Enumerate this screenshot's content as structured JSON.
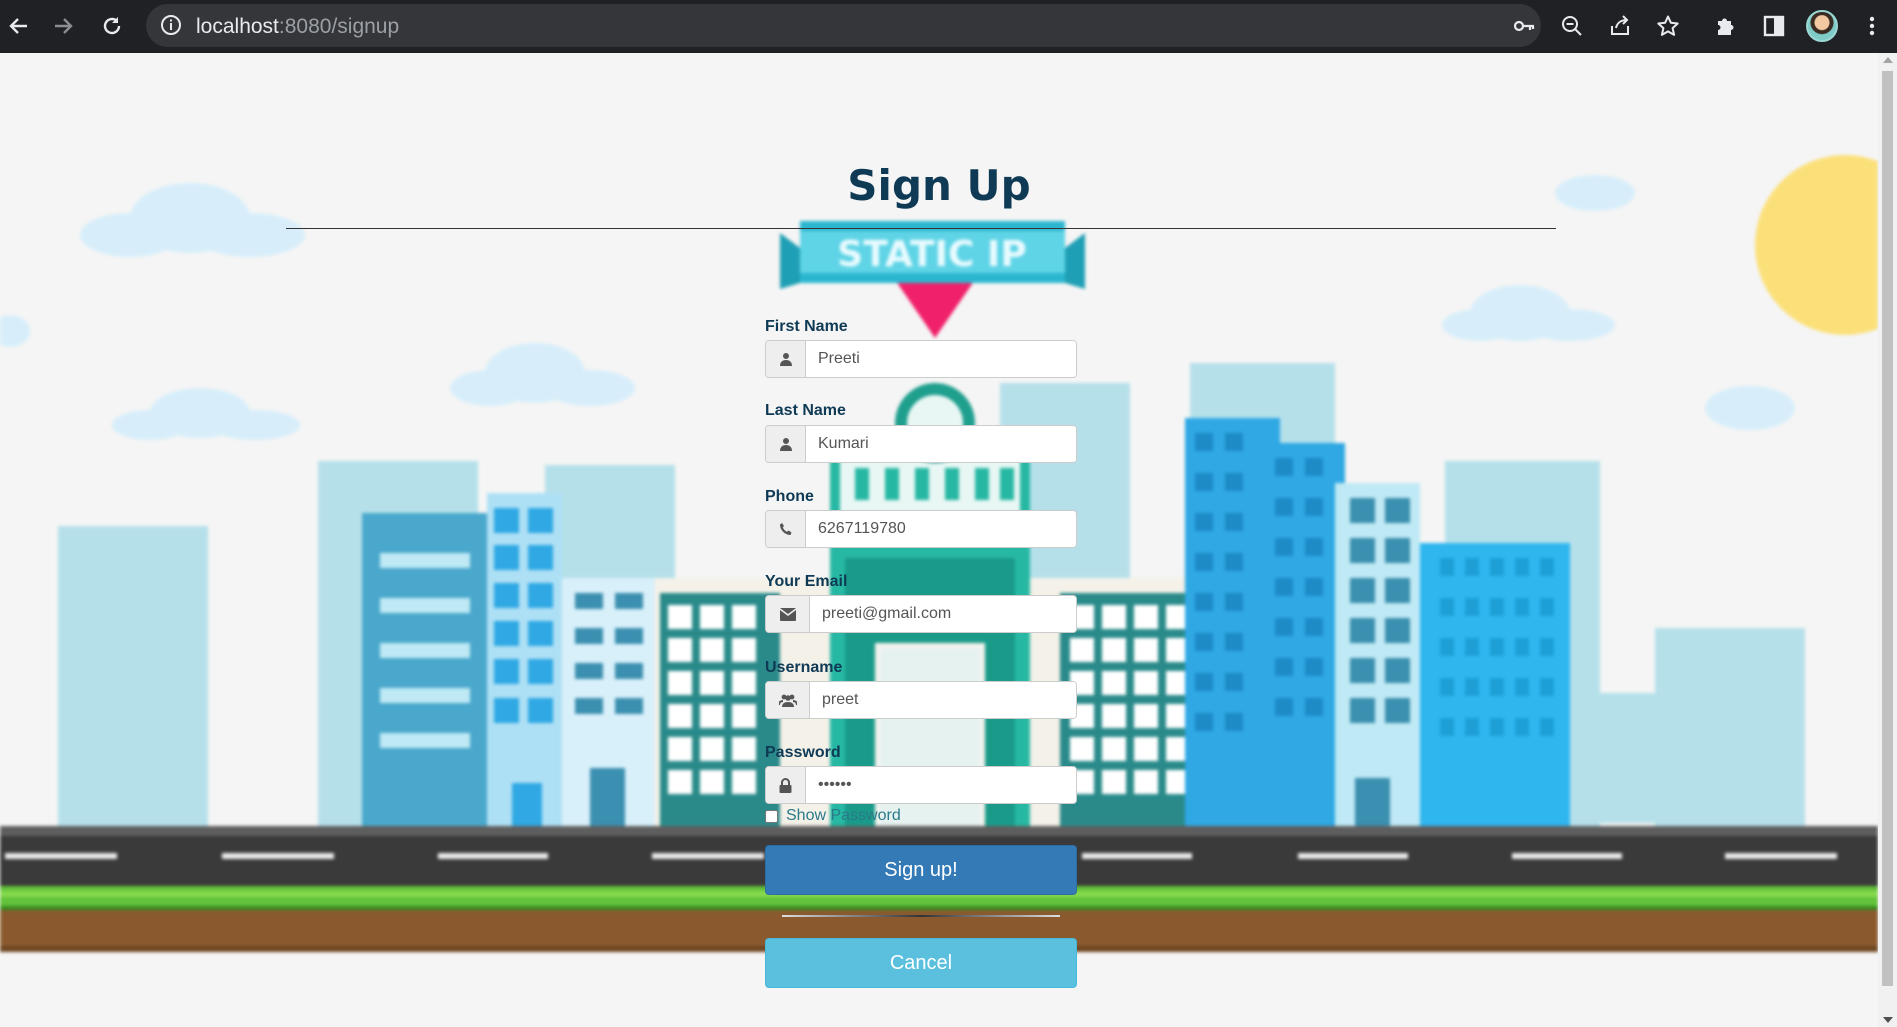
{
  "browser": {
    "url_host": "localhost",
    "url_path": ":8080/signup",
    "icons": {
      "back": "back-arrow-icon",
      "forward": "forward-arrow-icon",
      "reload": "reload-icon",
      "site_info": "info-icon",
      "password_key": "key-icon",
      "zoom": "zoom-out-icon",
      "share": "share-icon",
      "bookmark": "star-icon",
      "extensions": "puzzle-icon",
      "side_panel": "side-panel-icon",
      "menu": "kebab-menu-icon"
    }
  },
  "form": {
    "title": "Sign Up",
    "fields": [
      {
        "label": "First Name",
        "value": "Preeti",
        "icon": "user-icon"
      },
      {
        "label": "Last Name",
        "value": "Kumari",
        "icon": "user-icon"
      },
      {
        "label": "Phone",
        "value": "6267119780",
        "icon": "phone-icon"
      },
      {
        "label": "Your Email",
        "value": "preeti@gmail.com",
        "icon": "envelope-icon"
      },
      {
        "label": "Username",
        "value": "preet",
        "icon": "users-icon"
      },
      {
        "label": "Password",
        "value": "••••••",
        "icon": "lock-icon"
      }
    ],
    "show_password_label": "Show Password",
    "signup_label": "Sign up!",
    "cancel_label": "Cancel"
  },
  "background": {
    "sign_text": "STATIC IP"
  },
  "colors": {
    "primary": "#337ab7",
    "info": "#5bc0de",
    "title": "#0f3a55"
  }
}
